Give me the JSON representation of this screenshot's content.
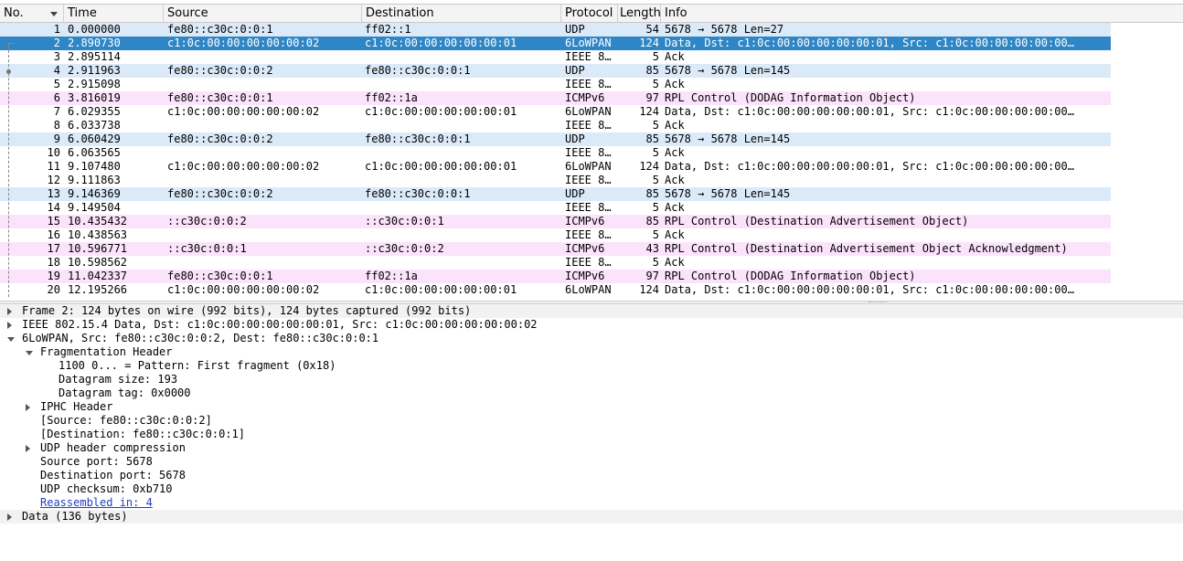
{
  "columns": [
    {
      "key": "no",
      "label": "No."
    },
    {
      "key": "time",
      "label": "Time"
    },
    {
      "key": "source",
      "label": "Source"
    },
    {
      "key": "destination",
      "label": "Destination"
    },
    {
      "key": "protocol",
      "label": "Protocol"
    },
    {
      "key": "length",
      "label": "Length"
    },
    {
      "key": "info",
      "label": "Info"
    }
  ],
  "packets": [
    {
      "no": "1",
      "time": "0.000000",
      "source": "fe80::c30c:0:0:1",
      "destination": "ff02::1",
      "protocol": "UDP",
      "length": "54",
      "info": "5678 → 5678 Len=27",
      "style": "udp"
    },
    {
      "no": "2",
      "time": "2.890730",
      "source": "c1:0c:00:00:00:00:00:02",
      "destination": "c1:0c:00:00:00:00:00:01",
      "protocol": "6LoWPAN",
      "length": "124",
      "info": "Data, Dst: c1:0c:00:00:00:00:00:01, Src: c1:0c:00:00:00:00:00…",
      "style": "sel"
    },
    {
      "no": "3",
      "time": "2.895114",
      "source": "",
      "destination": "",
      "protocol": "IEEE 8…",
      "length": "5",
      "info": "Ack",
      "style": "plain"
    },
    {
      "no": "4",
      "time": "2.911963",
      "source": "fe80::c30c:0:0:2",
      "destination": "fe80::c30c:0:0:1",
      "protocol": "UDP",
      "length": "85",
      "info": "5678 → 5678 Len=145",
      "style": "udp"
    },
    {
      "no": "5",
      "time": "2.915098",
      "source": "",
      "destination": "",
      "protocol": "IEEE 8…",
      "length": "5",
      "info": "Ack",
      "style": "plain"
    },
    {
      "no": "6",
      "time": "3.816019",
      "source": "fe80::c30c:0:0:1",
      "destination": "ff02::1a",
      "protocol": "ICMPv6",
      "length": "97",
      "info": "RPL Control (DODAG Information Object)",
      "style": "icmp"
    },
    {
      "no": "7",
      "time": "6.029355",
      "source": "c1:0c:00:00:00:00:00:02",
      "destination": "c1:0c:00:00:00:00:00:01",
      "protocol": "6LoWPAN",
      "length": "124",
      "info": "Data, Dst: c1:0c:00:00:00:00:00:01, Src: c1:0c:00:00:00:00:00…",
      "style": "plain"
    },
    {
      "no": "8",
      "time": "6.033738",
      "source": "",
      "destination": "",
      "protocol": "IEEE 8…",
      "length": "5",
      "info": "Ack",
      "style": "plain"
    },
    {
      "no": "9",
      "time": "6.060429",
      "source": "fe80::c30c:0:0:2",
      "destination": "fe80::c30c:0:0:1",
      "protocol": "UDP",
      "length": "85",
      "info": "5678 → 5678 Len=145",
      "style": "udp"
    },
    {
      "no": "10",
      "time": "6.063565",
      "source": "",
      "destination": "",
      "protocol": "IEEE 8…",
      "length": "5",
      "info": "Ack",
      "style": "plain"
    },
    {
      "no": "11",
      "time": "9.107480",
      "source": "c1:0c:00:00:00:00:00:02",
      "destination": "c1:0c:00:00:00:00:00:01",
      "protocol": "6LoWPAN",
      "length": "124",
      "info": "Data, Dst: c1:0c:00:00:00:00:00:01, Src: c1:0c:00:00:00:00:00…",
      "style": "plain"
    },
    {
      "no": "12",
      "time": "9.111863",
      "source": "",
      "destination": "",
      "protocol": "IEEE 8…",
      "length": "5",
      "info": "Ack",
      "style": "plain"
    },
    {
      "no": "13",
      "time": "9.146369",
      "source": "fe80::c30c:0:0:2",
      "destination": "fe80::c30c:0:0:1",
      "protocol": "UDP",
      "length": "85",
      "info": "5678 → 5678 Len=145",
      "style": "udp"
    },
    {
      "no": "14",
      "time": "9.149504",
      "source": "",
      "destination": "",
      "protocol": "IEEE 8…",
      "length": "5",
      "info": "Ack",
      "style": "plain"
    },
    {
      "no": "15",
      "time": "10.435432",
      "source": "::c30c:0:0:2",
      "destination": "::c30c:0:0:1",
      "protocol": "ICMPv6",
      "length": "85",
      "info": "RPL Control (Destination Advertisement Object)",
      "style": "icmp"
    },
    {
      "no": "16",
      "time": "10.438563",
      "source": "",
      "destination": "",
      "protocol": "IEEE 8…",
      "length": "5",
      "info": "Ack",
      "style": "plain"
    },
    {
      "no": "17",
      "time": "10.596771",
      "source": "::c30c:0:0:1",
      "destination": "::c30c:0:0:2",
      "protocol": "ICMPv6",
      "length": "43",
      "info": "RPL Control (Destination Advertisement Object Acknowledgment)",
      "style": "icmp"
    },
    {
      "no": "18",
      "time": "10.598562",
      "source": "",
      "destination": "",
      "protocol": "IEEE 8…",
      "length": "5",
      "info": "Ack",
      "style": "plain"
    },
    {
      "no": "19",
      "time": "11.042337",
      "source": "fe80::c30c:0:0:1",
      "destination": "ff02::1a",
      "protocol": "ICMPv6",
      "length": "97",
      "info": "RPL Control (DODAG Information Object)",
      "style": "icmp"
    },
    {
      "no": "20",
      "time": "12.195266",
      "source": "c1:0c:00:00:00:00:00:02",
      "destination": "c1:0c:00:00:00:00:00:01",
      "protocol": "6LoWPAN",
      "length": "124",
      "info": "Data, Dst: c1:0c:00:00:00:00:00:01, Src: c1:0c:00:00:00:00:00…",
      "style": "plain"
    }
  ],
  "details": [
    {
      "text": "Frame 2: 124 bytes on wire (992 bits), 124 bytes captured (992 bits)",
      "level": 0,
      "expander": "collapsed",
      "highlight": true
    },
    {
      "text": "IEEE 802.15.4 Data, Dst: c1:0c:00:00:00:00:00:01, Src: c1:0c:00:00:00:00:00:02",
      "level": 0,
      "expander": "collapsed",
      "highlight": false
    },
    {
      "text": "6LoWPAN, Src: fe80::c30c:0:0:2, Dest: fe80::c30c:0:0:1",
      "level": 0,
      "expander": "expanded",
      "highlight": false
    },
    {
      "text": "Fragmentation Header",
      "level": 1,
      "expander": "expanded",
      "highlight": false
    },
    {
      "text": "1100 0... = Pattern: First fragment (0x18)",
      "level": 2,
      "expander": "none",
      "highlight": false
    },
    {
      "text": "Datagram size: 193",
      "level": 2,
      "expander": "none",
      "highlight": false
    },
    {
      "text": "Datagram tag: 0x0000",
      "level": 2,
      "expander": "none",
      "highlight": false
    },
    {
      "text": "IPHC Header",
      "level": 1,
      "expander": "collapsed",
      "highlight": false
    },
    {
      "text": "[Source: fe80::c30c:0:0:2]",
      "level": 1,
      "expander": "none",
      "highlight": false
    },
    {
      "text": "[Destination: fe80::c30c:0:0:1]",
      "level": 1,
      "expander": "none",
      "highlight": false
    },
    {
      "text": "UDP header compression",
      "level": 1,
      "expander": "collapsed",
      "highlight": false
    },
    {
      "text": "Source port: 5678",
      "level": 1,
      "expander": "none",
      "highlight": false
    },
    {
      "text": "Destination port: 5678",
      "level": 1,
      "expander": "none",
      "highlight": false
    },
    {
      "text": "UDP checksum: 0xb710",
      "level": 1,
      "expander": "none",
      "highlight": false
    },
    {
      "text": "Reassembled in: 4",
      "level": 1,
      "expander": "none",
      "highlight": false,
      "link": true
    },
    {
      "text": "Data (136 bytes)",
      "level": 0,
      "expander": "collapsed",
      "highlight": true
    }
  ],
  "colors": {
    "selected": "#2e86c6",
    "udp": "#dbeaf8",
    "icmpv6": "#fbe3fb",
    "link": "#1f3fc4"
  },
  "icons": {
    "sort": "sort-descending-icon",
    "collapsed": "expand-arrow-icon",
    "expanded": "collapse-arrow-icon"
  }
}
